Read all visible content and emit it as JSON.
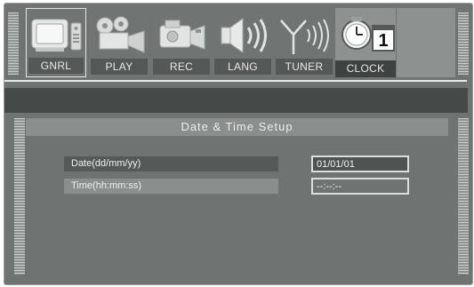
{
  "menu": {
    "tabs": [
      {
        "label": "GNRL",
        "icon": "tv-icon",
        "selected": true
      },
      {
        "label": "PLAY",
        "icon": "projector-icon",
        "selected": false
      },
      {
        "label": "REC",
        "icon": "camcorder-icon",
        "selected": false
      },
      {
        "label": "LANG",
        "icon": "speaker-icon",
        "selected": false
      },
      {
        "label": "TUNER",
        "icon": "antenna-icon",
        "selected": false
      },
      {
        "label": "CLOCK",
        "icon": "clock-calendar-icon",
        "selected": false,
        "highlighted": true
      }
    ],
    "calendar_day": "1"
  },
  "panel": {
    "title": "Date & Time Setup",
    "rows": [
      {
        "label": "Date(dd/mm/yy)",
        "value": "01/01/01"
      },
      {
        "label": "Time(hh:mm:ss)",
        "value": "--:--:--"
      }
    ]
  },
  "colors": {
    "background": "#6f7372",
    "status_bar": "#454948",
    "title_bar": "#8a8e8d",
    "tab_label": "#545857",
    "highlight": "#dcdedd"
  }
}
